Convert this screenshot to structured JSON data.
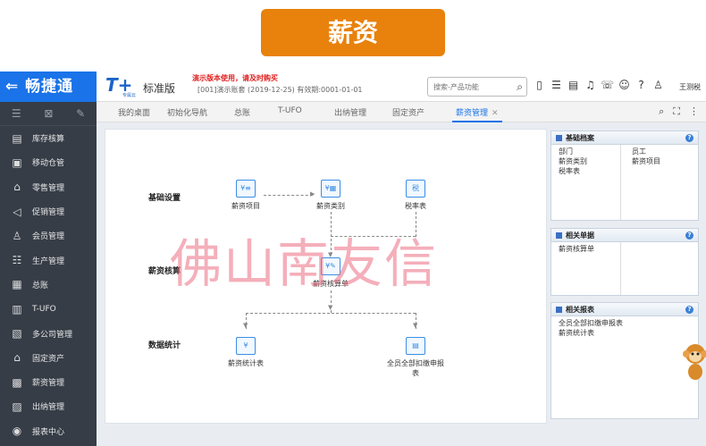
{
  "banner": {
    "title": "薪资"
  },
  "app": {
    "logo_text": "畅捷通",
    "product_mark": "T+",
    "product_sub": "专属云",
    "edition": "标准版",
    "demo_warning": "演示版本使用，请及时购买",
    "account_info": "[001]演示账套   (2019-12-25)   有效期:0001-01-01",
    "search_placeholder": "搜索-产品功能",
    "username": "王测税"
  },
  "sidebar": {
    "items": [
      {
        "label": "库存核算",
        "icon": "inventory-icon"
      },
      {
        "label": "移动仓管",
        "icon": "mobile-warehouse-icon"
      },
      {
        "label": "零售管理",
        "icon": "retail-icon"
      },
      {
        "label": "促销管理",
        "icon": "promotion-icon"
      },
      {
        "label": "会员管理",
        "icon": "member-icon"
      },
      {
        "label": "生产管理",
        "icon": "production-icon"
      },
      {
        "label": "总账",
        "icon": "ledger-icon"
      },
      {
        "label": "T-UFO",
        "icon": "ufo-icon"
      },
      {
        "label": "多公司管理",
        "icon": "company-icon"
      },
      {
        "label": "固定资产",
        "icon": "asset-icon"
      },
      {
        "label": "薪资管理",
        "icon": "salary-icon"
      },
      {
        "label": "出纳管理",
        "icon": "cashier-icon"
      },
      {
        "label": "报表中心",
        "icon": "report-icon"
      }
    ]
  },
  "tabs": [
    {
      "label": "我的桌面"
    },
    {
      "label": "初始化导航"
    },
    {
      "label": "总账"
    },
    {
      "label": "T-UFO"
    },
    {
      "label": "出纳管理"
    },
    {
      "label": "固定资产"
    },
    {
      "label": "薪资管理"
    }
  ],
  "flow": {
    "sections": {
      "setup": "基础设置",
      "calc": "薪资核算",
      "stats": "数据统计"
    },
    "nodes": {
      "salary_item": "薪资项目",
      "salary_category": "薪资类别",
      "tax_table": "税率表",
      "salary_register": "薪资核算单",
      "salary_stats": "薪资统计表",
      "staff_report": "全员全部扣缴申报表"
    }
  },
  "watermark": "佛山南友信",
  "panels": {
    "basic": {
      "title": "基础档案",
      "col1": [
        "部门",
        "薪资类别",
        "税率表"
      ],
      "col2": [
        "员工",
        "薪资项目"
      ]
    },
    "docs": {
      "title": "相关单据",
      "items": [
        "薪资核算单"
      ]
    },
    "reports": {
      "title": "相关报表",
      "items": [
        "全员全部扣缴申报表",
        "薪资统计表"
      ]
    }
  }
}
